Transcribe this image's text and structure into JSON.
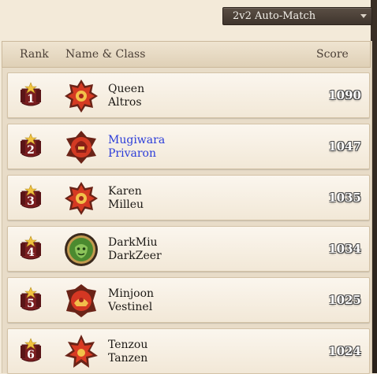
{
  "match_selector": {
    "value": "2v2 Auto-Match"
  },
  "table": {
    "columns": {
      "rank": "Rank",
      "name_class": "Name & Class",
      "score": "Score"
    },
    "rows": [
      {
        "rank": "1",
        "name": "Queen",
        "class": "Altros",
        "score": "1090",
        "emblem": "red-sun-emblem-icon",
        "highlight": false
      },
      {
        "rank": "2",
        "name": "Mugiwara",
        "class": "Privaron",
        "score": "1047",
        "emblem": "red-warrior-emblem-icon",
        "highlight": true
      },
      {
        "rank": "3",
        "name": "Karen",
        "class": "Milleu",
        "score": "1035",
        "emblem": "red-sun-emblem-icon",
        "highlight": false
      },
      {
        "rank": "4",
        "name": "DarkMiu",
        "class": "DarkZeer",
        "score": "1034",
        "emblem": "green-face-emblem-icon",
        "highlight": false
      },
      {
        "rank": "5",
        "name": "Minjoon",
        "class": "Vestinel",
        "score": "1025",
        "emblem": "red-crest-emblem-icon",
        "highlight": false
      },
      {
        "rank": "6",
        "name": "Tenzou",
        "class": "Tanzen",
        "score": "1024",
        "emblem": "red-star-emblem-icon",
        "highlight": false
      }
    ]
  },
  "colors": {
    "highlight_name": "#2b3cd9",
    "row_background": "#f8f1e6",
    "rank_badge": "#7a1e20"
  }
}
